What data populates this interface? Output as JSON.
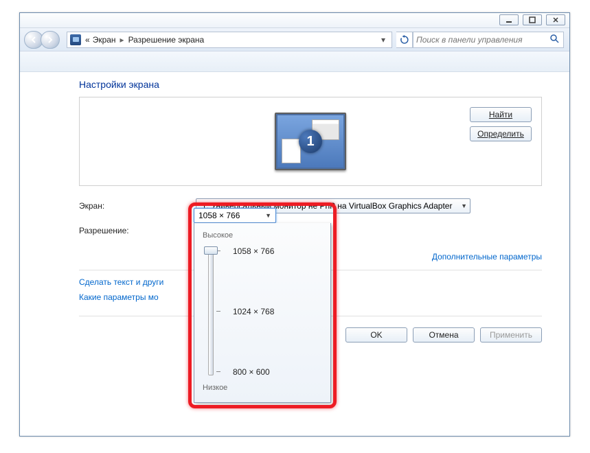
{
  "breadcrumb": {
    "prefix": "«",
    "item1": "Экран",
    "item2": "Разрешение экрана"
  },
  "search": {
    "placeholder": "Поиск в панели управления"
  },
  "page": {
    "title": "Настройки экрана"
  },
  "preview": {
    "btn_find": "Найти",
    "btn_identify": "Определить",
    "monitor_number": "1"
  },
  "form": {
    "screen_label": "Экран:",
    "screen_value": "1. Универсальный монитор не PnP на VirtualBox Graphics Adapter",
    "resolution_label": "Разрешение:",
    "resolution_value": "1058 × 766"
  },
  "advanced": "Дополнительные параметры",
  "help": {
    "l1": "Сделать текст и други",
    "l2": "Какие параметры мо"
  },
  "actions": {
    "ok": "OK",
    "cancel": "Отмена",
    "apply": "Применить"
  },
  "popup": {
    "high": "Высокое",
    "low": "Низкое",
    "r1": "1058 × 766",
    "r2": "1024 × 768",
    "r3": "800 × 600"
  }
}
